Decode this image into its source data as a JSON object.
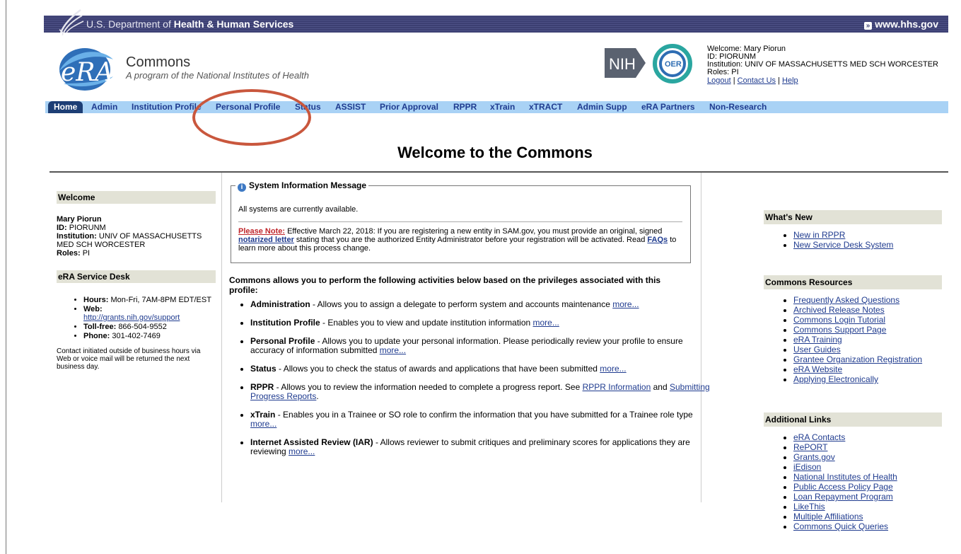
{
  "hhs": {
    "label_prefix": "U.S. Department of",
    "label_bold": "Health & Human Services",
    "link": "www.hhs.gov"
  },
  "header": {
    "app_title": "Commons",
    "app_subtitle": "A program of the National Institutes of Health",
    "logo_text": "eRA",
    "nih_text": "NIH",
    "oer_text": "OER"
  },
  "user": {
    "welcome": "Welcome: Mary Piorun",
    "id": "ID: PIORUNM",
    "institution": "Institution: UNIV OF MASSACHUSETTS MED SCH WORCESTER",
    "roles": "Roles:  PI",
    "logout": "Logout",
    "sep": "|",
    "contact": "Contact Us",
    "help": "Help"
  },
  "nav": {
    "home": "Home",
    "items": [
      "Admin",
      "Institution Profile",
      "Personal Profile",
      "Status",
      "ASSIST",
      "Prior Approval",
      "RPPR",
      "xTrain",
      "xTRACT",
      "Admin Supp",
      "eRA Partners",
      "Non-Research"
    ]
  },
  "page_title": "Welcome to the Commons",
  "left": {
    "welcome_header": "Welcome",
    "name": "Mary Piorun",
    "id_label": "ID:",
    "id_value": "PIORUNM",
    "inst_label": "Institution:",
    "inst_value": "UNIV OF MASSACHUSETTS MED SCH WORCESTER",
    "roles_label": "Roles:",
    "roles_value": "PI",
    "desk_header": "eRA Service Desk",
    "hours_label": "Hours:",
    "hours_value": "Mon-Fri, 7AM-8PM EDT/EST",
    "web_label": "Web:",
    "web_value": "http://grants.nih.gov/support",
    "tollfree_label": "Toll-free:",
    "tollfree_value": "866-504-9552",
    "phone_label": "Phone:",
    "phone_value": "301-402-7469",
    "contact_note": "Contact initiated outside of business hours via Web or voice mail will be returned the next business day."
  },
  "sysmsg": {
    "title": "System Information Message",
    "available": "All systems are currently available.",
    "note_label": "Please Note:",
    "note_text1": "Effective March 22, 2018: If you are registering a new entity in SAM.gov, you must provide an original, signed",
    "note_link1": "notarized letter",
    "note_text2": "stating that you are the authorized Entity Administrator before your registration will be activated. Read",
    "note_link2": "FAQs",
    "note_text3": "to learn more about this process change."
  },
  "intro": "Commons allows you to perform the following activities below based on the privileges associated with this profile:",
  "activities": [
    {
      "title": "Administration",
      "desc": " - Allows you to assign a delegate to perform system and accounts maintenance ",
      "more": "more..."
    },
    {
      "title": "Institution Profile",
      "desc": " - Enables you to view and update institution information ",
      "more": "more..."
    },
    {
      "title": "Personal Profile",
      "desc": " - Allows you to update your personal information. Please periodically review your profile to ensure accuracy of information submitted ",
      "more": "more..."
    },
    {
      "title": "Status",
      "desc": " - Allows you to check the status of awards and applications that have been submitted ",
      "more": "more..."
    },
    {
      "title": "RPPR",
      "desc": " - Allows you to review the information needed to complete a progress report. See ",
      "link1": "RPPR Information",
      "mid": " and ",
      "link2": "Submitting Progress Reports",
      "end": "."
    },
    {
      "title": "xTrain",
      "desc": " - Enables you in a Trainee or SO role to confirm the information that you have submitted for a Trainee role type ",
      "more": "more..."
    },
    {
      "title": "Internet Assisted Review (IAR)",
      "desc": " - Allows reviewer to submit critiques and preliminary scores for applications they are reviewing ",
      "more": "more..."
    }
  ],
  "right": {
    "whats_new": {
      "title": "What's New",
      "links": [
        "New in RPPR",
        "New Service Desk System"
      ]
    },
    "resources": {
      "title": "Commons Resources",
      "links": [
        "Frequently Asked Questions",
        "Archived Release Notes",
        "Commons Login Tutorial",
        "Commons Support Page",
        "eRA Training",
        "User Guides",
        "Grantee Organization Registration",
        "eRA Website",
        "Applying Electronically"
      ]
    },
    "additional": {
      "title": "Additional Links",
      "links": [
        "eRA Contacts",
        "RePORT",
        "Grants.gov",
        "iEdison",
        "National Institutes of Health",
        "Public Access Policy Page",
        "Loan Repayment Program",
        "LikeThis",
        "Multiple Affiliations",
        "Commons Quick Queries"
      ]
    }
  },
  "colors": {
    "banner": "#3c3f72",
    "nav_bg": "#a9d2f5",
    "nav_text": "#1f3b8f",
    "home_tab": "#1d3e75",
    "highlight_oval": "#c9573d",
    "note_red": "#c0262b"
  }
}
